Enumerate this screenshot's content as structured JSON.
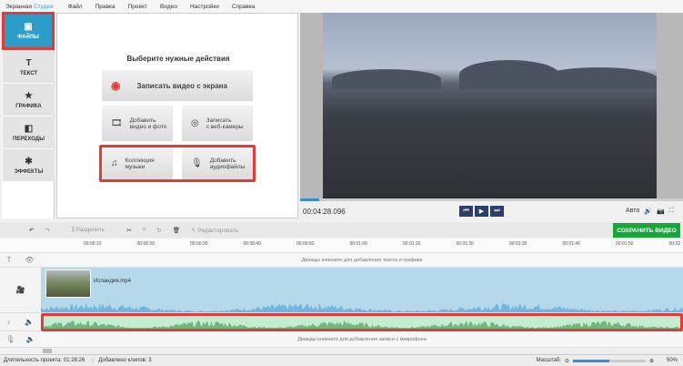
{
  "menu": {
    "brand_a": "Экранная",
    "brand_b": "Студия",
    "items": [
      "Файл",
      "Правка",
      "Проект",
      "Видео",
      "Настройки",
      "Справка"
    ]
  },
  "sidebar": {
    "items": [
      {
        "label": "ФАЙЛЫ",
        "icon": "image-icon"
      },
      {
        "label": "ТЕКСТ",
        "icon": "text-icon"
      },
      {
        "label": "ГРАФИКА",
        "icon": "star-icon"
      },
      {
        "label": "ПЕРЕХОДЫ",
        "icon": "transitions-icon"
      },
      {
        "label": "ЭФФЕКТЫ",
        "icon": "magic-wand-icon"
      }
    ]
  },
  "center": {
    "title": "Выберите нужные действия",
    "record_screen": "Записать видео с экрана",
    "add_video_1": "Добавить",
    "add_video_2": "видео и фото",
    "webcam_1": "Записать",
    "webcam_2": "с веб-камеры",
    "music_1": "Коллекция",
    "music_2": "музыки",
    "audio_1": "Добавить",
    "audio_2": "аудиофайлы"
  },
  "player": {
    "time": "00:04:28.096",
    "progress_percent": 5,
    "quality": "Авто"
  },
  "toolbar": {
    "split": "Разделить",
    "edit": "Редактировать",
    "save": "СОХРАНИТЬ ВИДЕО"
  },
  "ruler": [
    "00:00:10",
    "00:00:20",
    "00:00:30",
    "00:00:40",
    "00:00:50",
    "00:01:00",
    "00:01:10",
    "00:01:20",
    "00:01:30",
    "00:01:40",
    "00:01:50",
    "00:02"
  ],
  "tracks": {
    "text_hint": "Дважды кликните для добавления текста и графики",
    "clip_name": "Исландия.mp4",
    "mic_hint": "Дважды кликните для добавления записи с микрофона"
  },
  "status": {
    "duration_label": "Длительность проекта:",
    "duration": "01:28:26",
    "clips_label": "Добавлено клипов:",
    "clips": "3",
    "zoom_label": "Масштаб:",
    "zoom": "50%",
    "zoom_percent": 50
  },
  "colors": {
    "accent": "#2c9cc8",
    "save": "#1aa53a",
    "highlight": "#e53935"
  }
}
